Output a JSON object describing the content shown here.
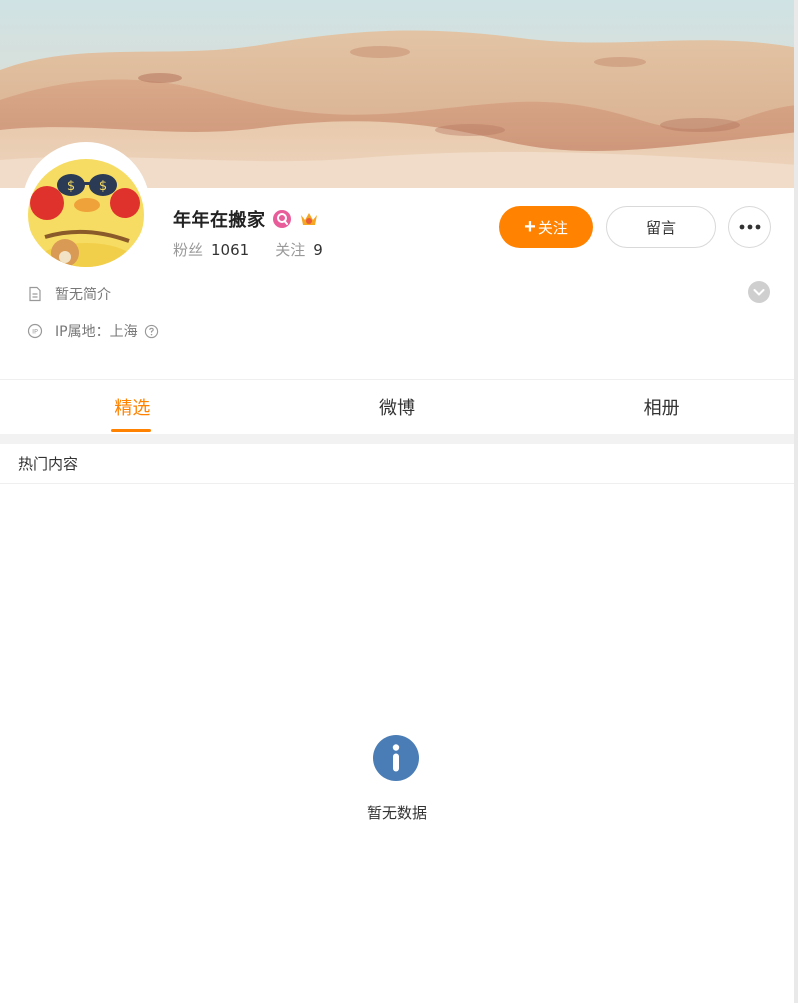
{
  "profile": {
    "name": "年年在搬家",
    "stats": [
      {
        "label": "粉丝",
        "value": "1061"
      },
      {
        "label": "关注",
        "value": "9"
      }
    ],
    "bio": "暂无简介",
    "ip_location": "IP属地：上海"
  },
  "actions": {
    "follow_plus": "+",
    "follow_label": "关注",
    "message_label": "留言"
  },
  "tabs": [
    {
      "label": "精选",
      "active": true
    },
    {
      "label": "微博",
      "active": false
    },
    {
      "label": "相册",
      "active": false
    }
  ],
  "section": {
    "title": "热门内容",
    "empty_text": "暂无数据"
  },
  "colors": {
    "accent": "#ff8200",
    "info_icon": "#4a7db5",
    "membership_badge": "#e85c9a",
    "crown_badge": "#f5a623"
  },
  "icons": {
    "bio": "document-icon",
    "ip": "ip-location-icon",
    "help": "question-circle-icon",
    "expand": "chevron-down-icon",
    "more": "more-horizontal-icon",
    "empty": "info-icon"
  }
}
